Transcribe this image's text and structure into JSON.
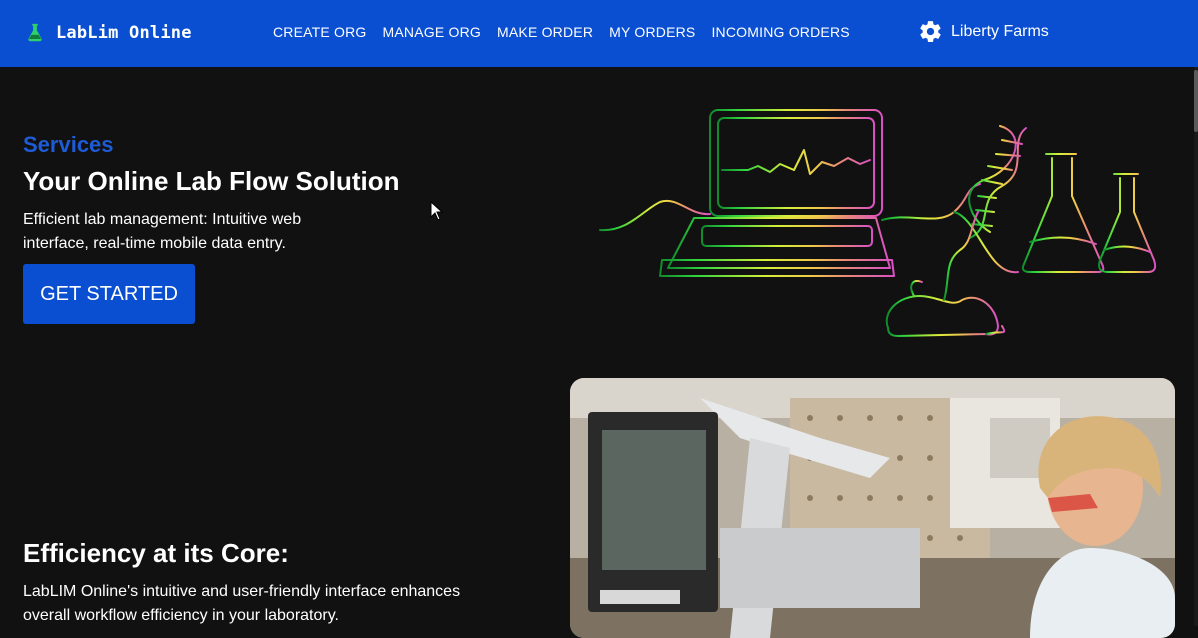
{
  "navbar": {
    "brand": {
      "name": "LabLim Online",
      "icon": "flask-icon"
    },
    "links": [
      {
        "label": "CREATE ORG"
      },
      {
        "label": "MANAGE ORG"
      },
      {
        "label": "MAKE ORDER"
      },
      {
        "label": "MY ORDERS"
      },
      {
        "label": "INCOMING ORDERS"
      }
    ],
    "user": {
      "name": "Liberty Farms",
      "icon": "gear-icon"
    },
    "background_color": "#0a4fd1"
  },
  "hero": {
    "eyebrow": "Services",
    "title": "Your Online Lab Flow Solution",
    "description": "Efficient lab management: Intuitive web interface, real-time mobile data entry.",
    "cta_label": "GET STARTED",
    "illustration": "line-art-lab-illustration"
  },
  "section": {
    "title": "Efficiency at its Core:",
    "description": "LabLIM Online's intuitive and user-friendly interface enhances overall workflow efficiency in your laboratory.",
    "photo": "lab-worker-photo"
  },
  "colors": {
    "accent": "#1e5bd6",
    "background": "#111111",
    "text": "#ffffff"
  }
}
